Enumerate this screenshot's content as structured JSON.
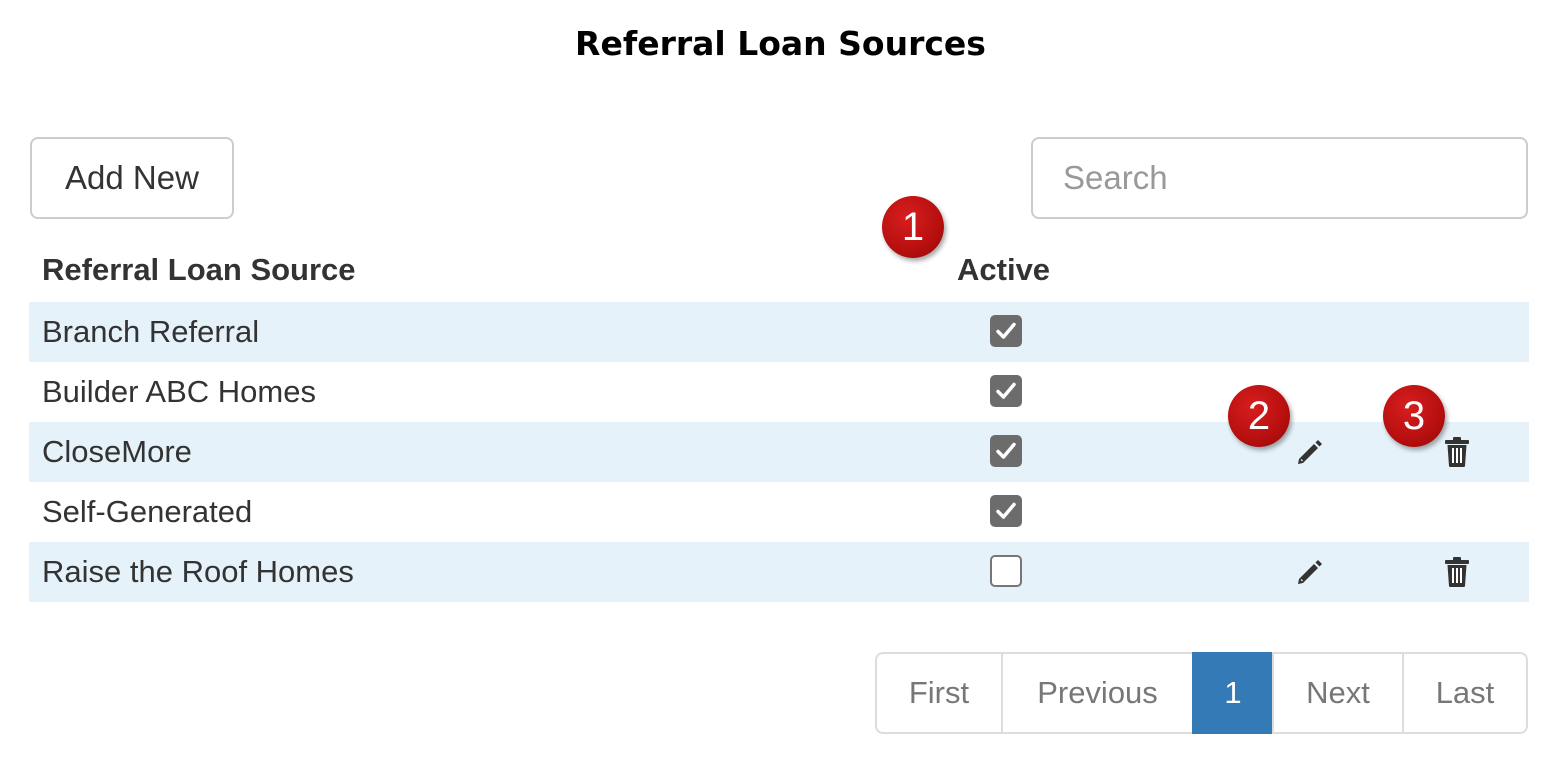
{
  "page": {
    "title": "Referral Loan Sources"
  },
  "toolbar": {
    "add_label": "Add New",
    "search_placeholder": "Search"
  },
  "table": {
    "columns": {
      "name": "Referral Loan Source",
      "active": "Active"
    },
    "rows": [
      {
        "name": "Branch Referral",
        "active": true,
        "actions": false
      },
      {
        "name": "Builder ABC Homes",
        "active": true,
        "actions": false
      },
      {
        "name": "CloseMore",
        "active": true,
        "actions": true
      },
      {
        "name": "Self-Generated",
        "active": true,
        "actions": false
      },
      {
        "name": "Raise the Roof Homes",
        "active": false,
        "actions": true
      }
    ]
  },
  "markers": [
    "1",
    "2",
    "3"
  ],
  "pagination": {
    "first": "First",
    "previous": "Previous",
    "current": "1",
    "next": "Next",
    "last": "Last"
  },
  "icons": {
    "edit": "pencil-icon",
    "delete": "trash-icon",
    "check": "checkmark-icon"
  },
  "colors": {
    "accent": "#337ab7",
    "stripe": "#e5f2f9",
    "marker": "#c41414",
    "checkbox_on": "#6c6c6c"
  }
}
